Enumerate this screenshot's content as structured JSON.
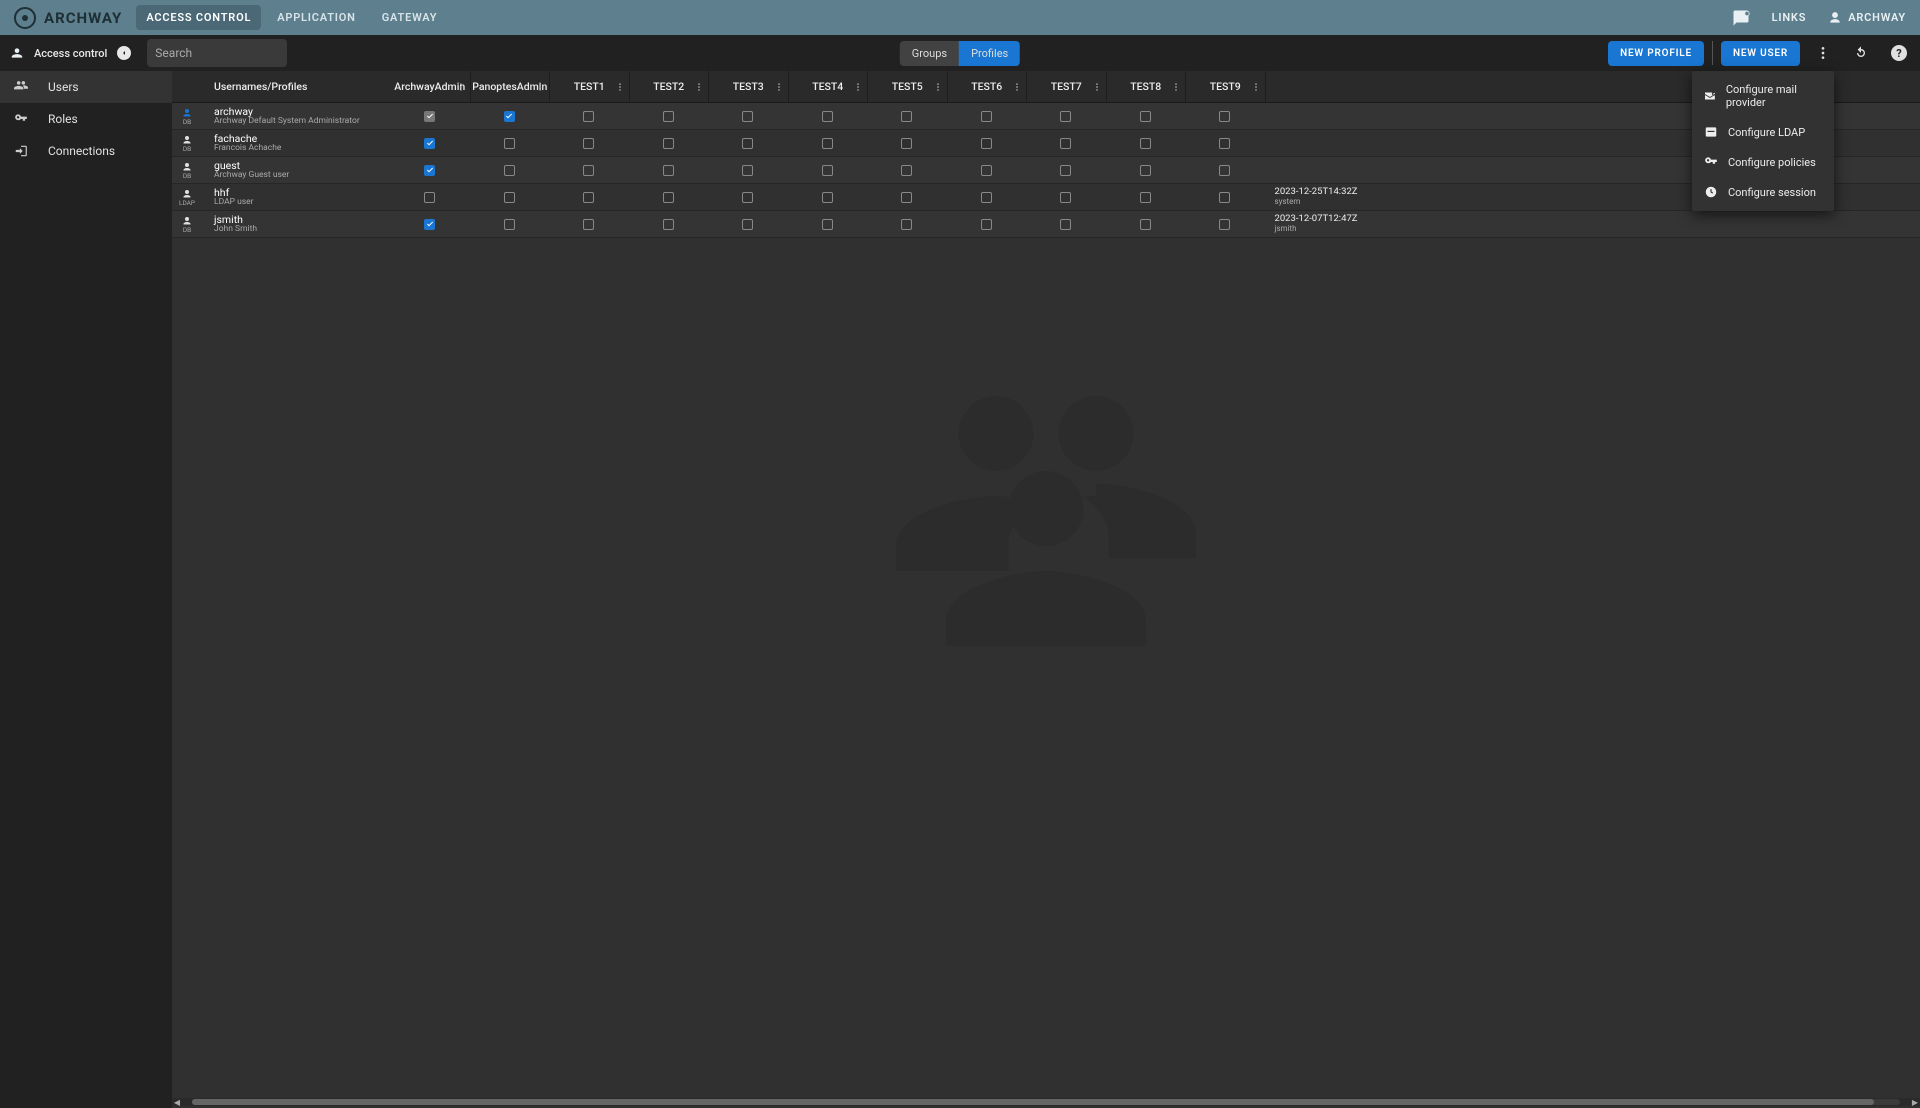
{
  "brand": "ARCHWAY",
  "topnav": [
    "ACCESS CONTROL",
    "APPLICATION",
    "GATEWAY"
  ],
  "topnav_active": 0,
  "top_links_label": "LINKS",
  "top_user_label": "ARCHWAY",
  "toolbar": {
    "title": "Access control",
    "search_placeholder": "Search",
    "seg": [
      "Groups",
      "Profiles"
    ],
    "seg_active": 1,
    "new_profile": "NEW PROFILE",
    "new_user": "NEW USER"
  },
  "sidebar": [
    {
      "label": "Users",
      "icon": "group"
    },
    {
      "label": "Roles",
      "icon": "key"
    },
    {
      "label": "Connections",
      "icon": "login"
    }
  ],
  "sidebar_active": 0,
  "table": {
    "col_name": "Usernames/Profiles",
    "profiles": [
      "ArchwayAdmin",
      "PanoptesAdmin",
      "TEST1",
      "TEST2",
      "TEST3",
      "TEST4",
      "TEST5",
      "TEST6",
      "TEST7",
      "TEST8",
      "TEST9"
    ],
    "rows": [
      {
        "user": "archway",
        "desc": "Archway Default System Administrator",
        "src": "DB",
        "avatar": "blue",
        "checks": [
          "disabled-on",
          "on",
          "off",
          "off",
          "off",
          "off",
          "off",
          "off",
          "off",
          "off",
          "off"
        ],
        "date": "",
        "by": ""
      },
      {
        "user": "fachache",
        "desc": "Francois Achache",
        "src": "DB",
        "avatar": "white",
        "checks": [
          "on",
          "off",
          "off",
          "off",
          "off",
          "off",
          "off",
          "off",
          "off",
          "off",
          "off"
        ],
        "date": "",
        "by": ""
      },
      {
        "user": "guest",
        "desc": "Archway Guest user",
        "src": "DB",
        "avatar": "white",
        "checks": [
          "on",
          "off",
          "off",
          "off",
          "off",
          "off",
          "off",
          "off",
          "off",
          "off",
          "off"
        ],
        "date": "",
        "by": ""
      },
      {
        "user": "hhf",
        "desc": "LDAP user",
        "src": "LDAP",
        "avatar": "white",
        "checks": [
          "off",
          "off",
          "off",
          "off",
          "off",
          "off",
          "off",
          "off",
          "off",
          "off",
          "off"
        ],
        "date": "2023-12-25T14:32Z",
        "by": "system"
      },
      {
        "user": "jsmith",
        "desc": "John Smith",
        "src": "DB",
        "avatar": "white",
        "checks": [
          "on",
          "off",
          "off",
          "off",
          "off",
          "off",
          "off",
          "off",
          "off",
          "off",
          "off"
        ],
        "date": "2023-12-07T12:47Z",
        "by": "jsmith"
      }
    ]
  },
  "popup": [
    {
      "label": "Configure mail provider",
      "icon": "mail"
    },
    {
      "label": "Configure LDAP",
      "icon": "ldap"
    },
    {
      "label": "Configure policies",
      "icon": "key"
    },
    {
      "label": "Configure session",
      "icon": "clock"
    }
  ]
}
